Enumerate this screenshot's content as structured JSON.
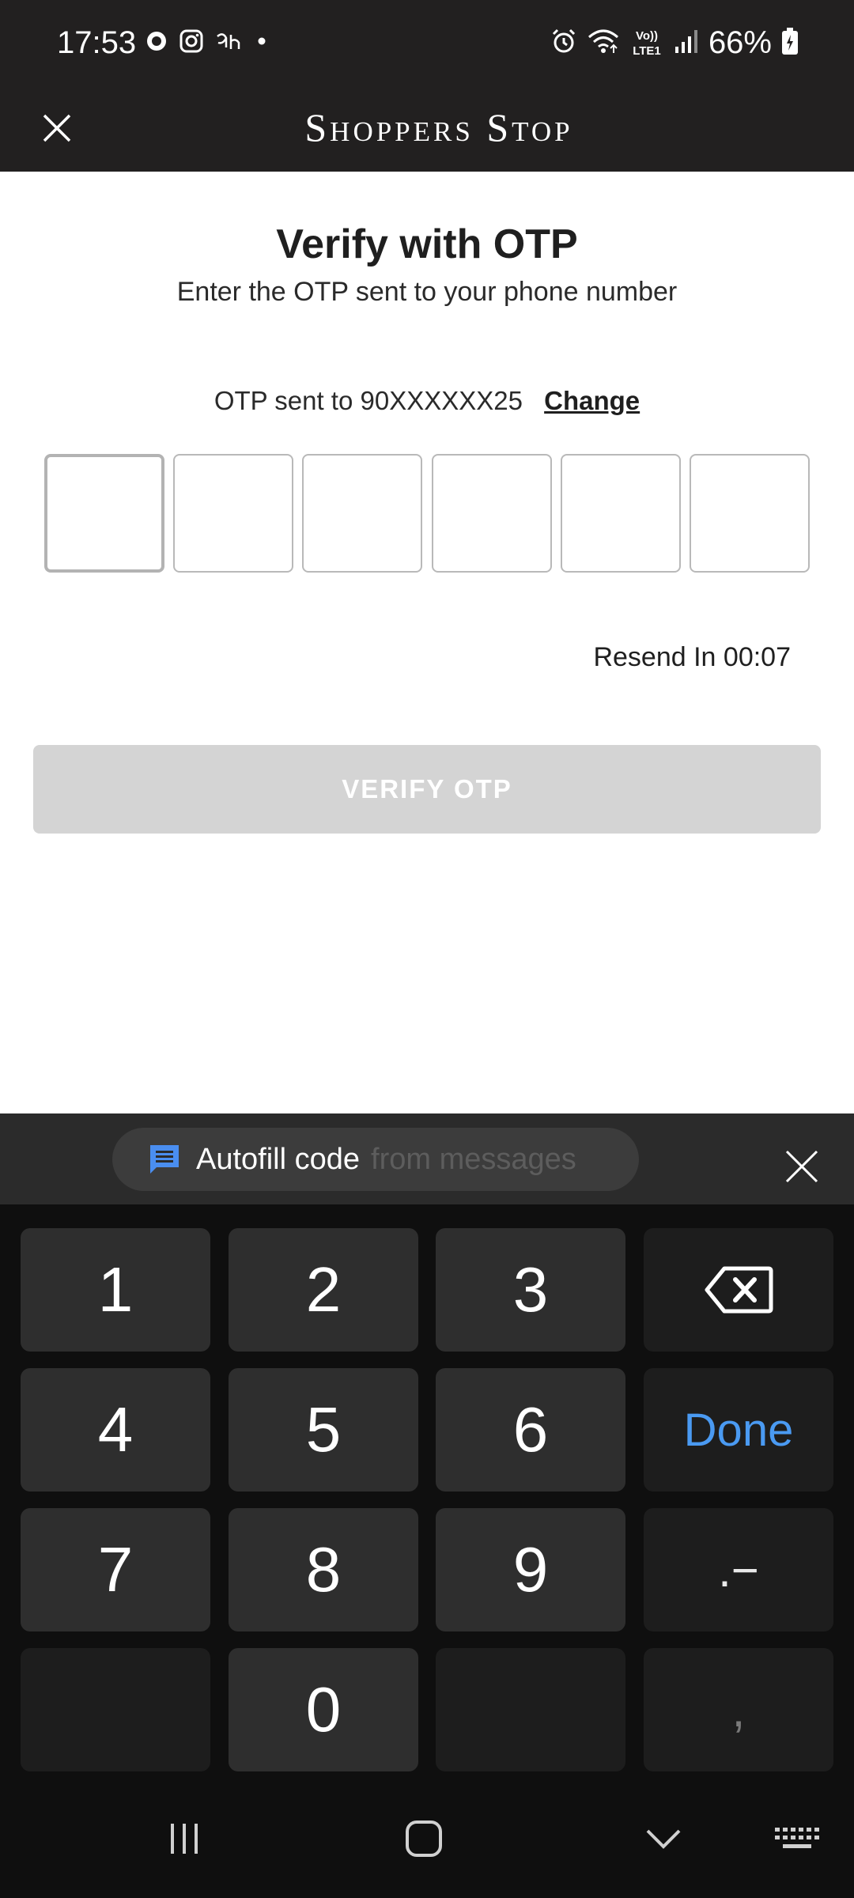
{
  "status_bar": {
    "time": "17:53",
    "battery": "66%",
    "left_icons": [
      "data-saver-icon",
      "instagram-icon",
      "bengali-app-icon",
      "notification-dot-icon"
    ],
    "right_icons": [
      "alarm-icon",
      "wifi-icon",
      "volte-icon",
      "signal-icon",
      "battery-icon"
    ],
    "volte_label": "Vo)) LTE1"
  },
  "header": {
    "brand": "Shoppers Stop",
    "close_icon": "close-icon"
  },
  "main": {
    "title": "Verify with OTP",
    "subtitle": "Enter the OTP sent to your phone number",
    "sent_to_label": "OTP sent to 90XXXXXX25",
    "change_link": "Change",
    "otp_digits": [
      "",
      "",
      "",
      "",
      "",
      ""
    ],
    "resend_label": "Resend In 00:07",
    "verify_button": "VERIFY OTP"
  },
  "autofill": {
    "main_text": "Autofill code",
    "secondary_text": "from messages",
    "icon": "message-icon",
    "close_icon": "close-icon"
  },
  "keypad": {
    "keys": {
      "k1": "1",
      "k2": "2",
      "k3": "3",
      "k4": "4",
      "k5": "5",
      "k6": "6",
      "k7": "7",
      "k8": "8",
      "k9": "9",
      "k0": "0",
      "done": "Done",
      "symbol": ".−",
      "comma": ","
    },
    "backspace_icon": "backspace-icon"
  },
  "navigation": {
    "icons": [
      "recent-apps-icon",
      "home-icon",
      "back-icon",
      "keyboard-icon"
    ]
  },
  "colors": {
    "header_bg": "#222020",
    "accent_done": "#4a9af2",
    "verify_disabled": "#d4d4d4",
    "autofill_icon": "#4a8ef0"
  }
}
